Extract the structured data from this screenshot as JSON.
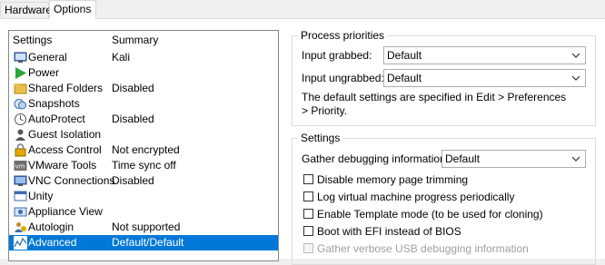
{
  "tabs": [
    {
      "label": "Hardware"
    },
    {
      "label": "Options"
    }
  ],
  "list": {
    "header": {
      "settings": "Settings",
      "summary": "Summary"
    },
    "items": [
      {
        "name": "General",
        "summary": "Kali",
        "icon": "general-icon"
      },
      {
        "name": "Power",
        "summary": "",
        "icon": "power-play-icon"
      },
      {
        "name": "Shared Folders",
        "summary": "Disabled",
        "icon": "shared-folders-icon"
      },
      {
        "name": "Snapshots",
        "summary": "",
        "icon": "snapshots-icon"
      },
      {
        "name": "AutoProtect",
        "summary": "Disabled",
        "icon": "autoprotect-icon"
      },
      {
        "name": "Guest Isolation",
        "summary": "",
        "icon": "guest-isolation-icon"
      },
      {
        "name": "Access Control",
        "summary": "Not encrypted",
        "icon": "access-control-icon"
      },
      {
        "name": "VMware Tools",
        "summary": "Time sync off",
        "icon": "vmware-tools-icon"
      },
      {
        "name": "VNC Connections",
        "summary": "Disabled",
        "icon": "vnc-icon"
      },
      {
        "name": "Unity",
        "summary": "",
        "icon": "unity-icon"
      },
      {
        "name": "Appliance View",
        "summary": "",
        "icon": "appliance-view-icon"
      },
      {
        "name": "Autologin",
        "summary": "Not supported",
        "icon": "autologin-icon"
      },
      {
        "name": "Advanced",
        "summary": "Default/Default",
        "icon": "advanced-icon",
        "selected": true
      }
    ]
  },
  "process_priorities": {
    "title": "Process priorities",
    "input_grabbed_label": "Input grabbed:",
    "input_grabbed_value": "Default",
    "input_ungrabbed_label": "Input ungrabbed:",
    "input_ungrabbed_value": "Default",
    "note": "The default settings are specified in Edit > Preferences > Priority."
  },
  "settings": {
    "title": "Settings",
    "debug_label": "Gather debugging information:",
    "debug_value": "Default",
    "checkboxes": [
      {
        "label": "Disable memory page trimming",
        "checked": false,
        "enabled": true
      },
      {
        "label": "Log virtual machine progress periodically",
        "checked": false,
        "enabled": true
      },
      {
        "label": "Enable Template mode (to be used for cloning)",
        "checked": false,
        "enabled": true
      },
      {
        "label": "Boot with EFI instead of BIOS",
        "checked": false,
        "enabled": true
      },
      {
        "label": "Gather verbose USB debugging information",
        "checked": false,
        "enabled": false
      }
    ]
  },
  "colors": {
    "selection": "#0078d7",
    "border": "#828790"
  }
}
